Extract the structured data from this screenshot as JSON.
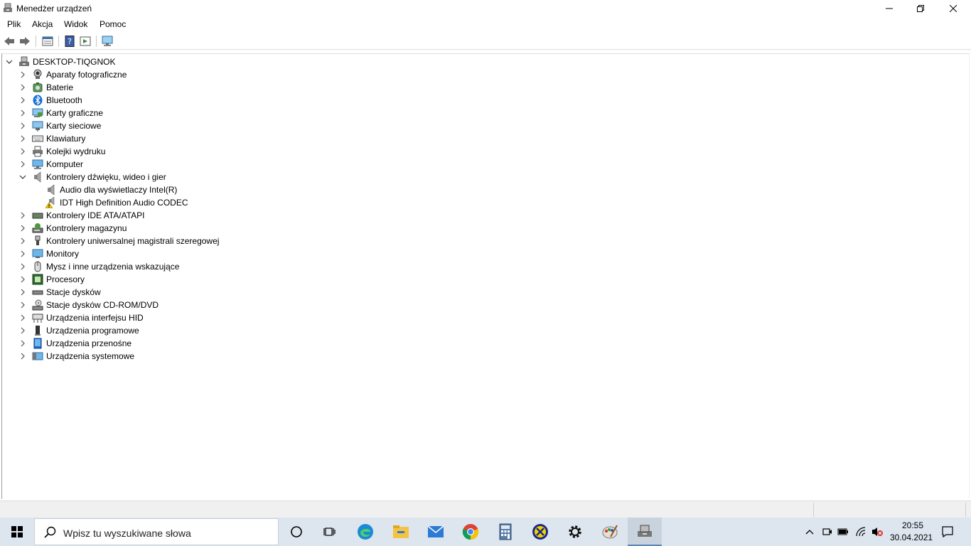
{
  "window": {
    "title": "Menedżer urządzeń"
  },
  "menu": {
    "items": [
      "Plik",
      "Akcja",
      "Widok",
      "Pomoc"
    ]
  },
  "tree": {
    "root": "DESKTOP-TIQGNOK",
    "categories": [
      {
        "label": "Aparaty fotograficzne",
        "icon": "camera-icon",
        "expanded": false
      },
      {
        "label": "Baterie",
        "icon": "battery-icon",
        "expanded": false
      },
      {
        "label": "Bluetooth",
        "icon": "bluetooth-icon",
        "expanded": false
      },
      {
        "label": "Karty graficzne",
        "icon": "display-adapter-icon",
        "expanded": false
      },
      {
        "label": "Karty sieciowe",
        "icon": "network-adapter-icon",
        "expanded": false
      },
      {
        "label": "Klawiatury",
        "icon": "keyboard-icon",
        "expanded": false
      },
      {
        "label": "Kolejki wydruku",
        "icon": "printer-icon",
        "expanded": false
      },
      {
        "label": "Komputer",
        "icon": "computer-icon",
        "expanded": false
      },
      {
        "label": "Kontrolery dźwięku, wideo i gier",
        "icon": "speaker-icon",
        "expanded": true,
        "children": [
          {
            "label": "Audio dla wyświetlaczy Intel(R)",
            "icon": "speaker-icon",
            "warning": false
          },
          {
            "label": "IDT High Definition Audio CODEC",
            "icon": "warning-speaker-icon",
            "warning": true
          }
        ]
      },
      {
        "label": "Kontrolery IDE ATA/ATAPI",
        "icon": "ide-controller-icon",
        "expanded": false
      },
      {
        "label": "Kontrolery magazynu",
        "icon": "storage-controller-icon",
        "expanded": false
      },
      {
        "label": "Kontrolery uniwersalnej magistrali szeregowej",
        "icon": "usb-icon",
        "expanded": false
      },
      {
        "label": "Monitory",
        "icon": "monitor-icon",
        "expanded": false
      },
      {
        "label": "Mysz i inne urządzenia wskazujące",
        "icon": "mouse-icon",
        "expanded": false
      },
      {
        "label": "Procesory",
        "icon": "processor-icon",
        "expanded": false
      },
      {
        "label": "Stacje dysków",
        "icon": "disk-drive-icon",
        "expanded": false
      },
      {
        "label": "Stacje dysków CD-ROM/DVD",
        "icon": "cdrom-icon",
        "expanded": false
      },
      {
        "label": "Urządzenia interfejsu HID",
        "icon": "hid-icon",
        "expanded": false
      },
      {
        "label": "Urządzenia programowe",
        "icon": "software-device-icon",
        "expanded": false
      },
      {
        "label": "Urządzenia przenośne",
        "icon": "portable-device-icon",
        "expanded": false
      },
      {
        "label": "Urządzenia systemowe",
        "icon": "system-device-icon",
        "expanded": false
      }
    ]
  },
  "taskbar": {
    "search_placeholder": "Wpisz tu wyszukiwane słowa",
    "apps": [
      "cortana-icon",
      "task-view-icon",
      "edge-icon",
      "file-explorer-icon",
      "mail-icon",
      "chrome-icon",
      "calculator-icon",
      "app-yellow-icon",
      "settings-icon",
      "paint-icon",
      "device-manager-icon"
    ],
    "clock": {
      "time": "20:55",
      "date": "30.04.2021"
    }
  }
}
